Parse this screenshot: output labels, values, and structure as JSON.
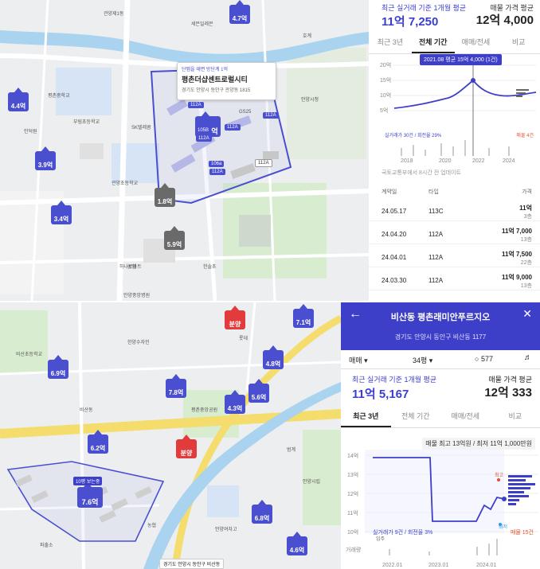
{
  "map1": {
    "popup": {
      "badge": "단맵을 떼면 방단계 1억",
      "title": "평촌더샵센트로럴시티",
      "address": "경기도 안양시 동안구 관양동 1815"
    },
    "pins": [
      {
        "price": "4.7억"
      },
      {
        "price": "4.4억"
      },
      {
        "price": "3.9억"
      },
      {
        "price": "3.4억"
      },
      {
        "price": "11.7억"
      },
      {
        "price": "1.8억"
      },
      {
        "price": "5.9억"
      }
    ],
    "units": [
      "112A",
      "112A",
      "112A",
      "105B",
      "112A",
      "106a",
      "112A",
      "112A"
    ],
    "labels": [
      "관양제1동",
      "평촌중학교",
      "SK텔레콤",
      "안양시청",
      "부림초등학교",
      "하나로마트",
      "호계",
      "관양초등학교",
      "인덕원",
      "농협",
      "세븐일레븐",
      "GS25",
      "안양중앙병원",
      "한솔초"
    ]
  },
  "panel1": {
    "left_title": "최근 실거래 기준 1개월 평균",
    "left_value": "11억 7,250",
    "right_title": "매물 가격 평균",
    "right_value": "12억 4,000",
    "tabs": [
      "최근 3년",
      "전체 기간",
      "매매/전세",
      "비교"
    ],
    "active_tab": 1,
    "tooltip": "2021.08 평균 15억 4,000 (1건)",
    "y_ticks": [
      "20억",
      "15억",
      "10억",
      "5억"
    ],
    "x_ticks": [
      "2018",
      "2020",
      "2022",
      "2024"
    ],
    "legend_left": "실거래가 30건 / 회전율 29%",
    "legend_right": "매물 4건",
    "note": "국토교통부에서 8시간 전 업데이트",
    "table_headers": [
      "계약일",
      "타입",
      "가격"
    ],
    "rows": [
      {
        "date": "24.05.17",
        "type": "113C",
        "price": "11억",
        "floor": "3층"
      },
      {
        "date": "24.04.20",
        "type": "112A",
        "price": "11억 7,000",
        "floor": "13층"
      },
      {
        "date": "24.04.01",
        "type": "112A",
        "price": "11억 7,500",
        "floor": "22층"
      },
      {
        "date": "24.03.30",
        "type": "112A",
        "price": "11억 9,000",
        "floor": "13층"
      }
    ]
  },
  "map2": {
    "pins": [
      {
        "price": "분양"
      },
      {
        "price": "7.1억"
      },
      {
        "price": "6.9억"
      },
      {
        "price": "4.8억"
      },
      {
        "price": "7.8억"
      },
      {
        "price": "5.6억"
      },
      {
        "price": "4.3억"
      },
      {
        "price": "6.2억"
      },
      {
        "price": "분양"
      },
      {
        "price": "7.6억"
      },
      {
        "price": "6.8억"
      },
      {
        "price": "4.6억"
      }
    ],
    "selected_label": "10평 보는중",
    "bottom_label": "경기도 안양시 동안구 비산동",
    "labels": [
      "비산초등학교",
      "평촌중앙공원",
      "안양시립",
      "한양수자인",
      "안양여자고",
      "비산동",
      "범계",
      "롯데",
      "농협",
      "파출소"
    ]
  },
  "panel2": {
    "title": "비산동 평촌래미안푸르지오",
    "address": "경기도 안양시 동안구 비산동 1177",
    "trade": "매매",
    "size": "34평",
    "comments": "577",
    "left_title": "최근 실거래 기준 1개월 평균",
    "left_value": "11억 5,167",
    "right_title": "매물 가격 평균",
    "right_value": "12억 333",
    "tabs": [
      "최근 3년",
      "전체 기간",
      "매매/전세",
      "비교"
    ],
    "active_tab": 0,
    "info": "매물 최고 13억원 / 최저 11억 1,000만원",
    "y_ticks": [
      "14억",
      "13억",
      "12억",
      "11억",
      "10억"
    ],
    "x_ticks": [
      "2022.01",
      "2023.01",
      "2024.01"
    ],
    "legend_left": "실거래가 9건 / 회전율 3%",
    "legend_right": "매물 15건",
    "high_label": "최고",
    "low_label": "최저",
    "volume_label": "거래량",
    "now_label": "입주"
  },
  "colors": {
    "accent": "#3d3fc8",
    "pin": "#4a4fd0",
    "red": "#e23b3b"
  }
}
